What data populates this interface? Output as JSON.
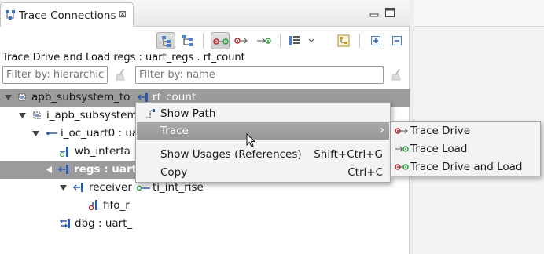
{
  "view": {
    "title": "Trace Connections",
    "close_glyph": "⊠",
    "description": "Trace Drive and Load regs : uart_regs . rf_count"
  },
  "filters": {
    "hierarchy_placeholder": "Filter by: hierarchic",
    "name_placeholder": "Filter by: name"
  },
  "toolbar": {
    "icons": [
      "hierarchy-mode-icon",
      "flat-mode-icon",
      "trace-drive-and-load-icon",
      "trace-drive-icon",
      "trace-load-icon",
      "column-layout-icon",
      "dropdown-chevron-icon",
      "link-editor-icon",
      "expand-all-icon",
      "collapse-all-icon"
    ]
  },
  "tree": {
    "rows": [
      {
        "label": "apb_subsystem_to",
        "icon": "chip-icon"
      },
      {
        "label": "i_apb_subsystem",
        "icon": "chip-icon"
      },
      {
        "label": "i_oc_uart0 : ua",
        "icon": "instance-icon"
      },
      {
        "label": "wb_interfa",
        "icon": "port-icon"
      },
      {
        "label": "regs : uart",
        "icon": "port-in-icon"
      },
      {
        "label": "receiver",
        "icon": "port-in-icon"
      },
      {
        "label": "fifo_r",
        "icon": "signal-icon"
      },
      {
        "label": "dbg : uart_",
        "icon": "bidir-icon"
      }
    ]
  },
  "connections": {
    "items": [
      {
        "label": "rf_count",
        "icon": "port-in-icon"
      },
      {
        "label": "ti_int_rise",
        "icon": "load-icon"
      }
    ]
  },
  "context_menu": {
    "items": [
      {
        "label": "Show Path",
        "shortcut": ""
      },
      {
        "label": "Trace",
        "shortcut": ""
      },
      {
        "label": "Show Usages (References)",
        "shortcut": "Shift+Ctrl+G"
      },
      {
        "label": "Copy",
        "shortcut": "Ctrl+C"
      }
    ],
    "submenu_arrow": "›"
  },
  "trace_submenu": {
    "items": [
      {
        "label": "Trace Drive",
        "icon": "trace-drive-icon"
      },
      {
        "label": "Trace Load",
        "icon": "trace-load-icon"
      },
      {
        "label": "Trace Drive and Load",
        "icon": "trace-drive-and-load-icon"
      }
    ]
  },
  "colors": {
    "selection": "#9b9b9b",
    "menu_highlight": "#a0a0a0",
    "drive_red": "#c0262d",
    "load_green": "#2e9e3c",
    "port_blue": "#2a5db0"
  }
}
